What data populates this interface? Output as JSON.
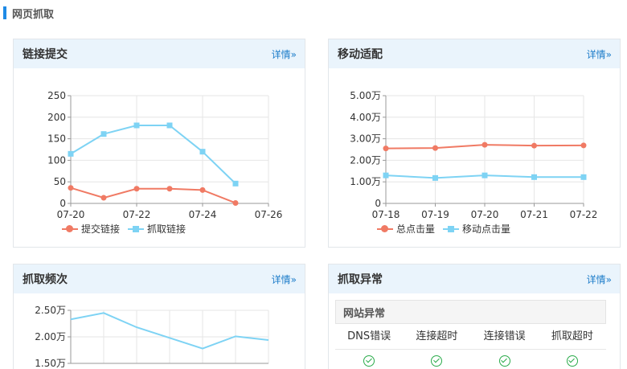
{
  "section": {
    "title": "网页抓取"
  },
  "cards": {
    "link_submit": {
      "title": "链接提交",
      "more_label": "详情»"
    },
    "mobile_adapt": {
      "title": "移动适配",
      "more_label": "详情»"
    },
    "crawl_freq": {
      "title": "抓取频次",
      "more_label": "详情»"
    },
    "crawl_error": {
      "title": "抓取异常",
      "more_label": "详情»",
      "sub_title": "网站异常",
      "columns": [
        "DNS错误",
        "连接超时",
        "连接错误",
        "抓取超时"
      ],
      "status": [
        "ok",
        "ok",
        "ok",
        "ok"
      ]
    }
  },
  "colors": {
    "red_series": "#f07a64",
    "blue_series": "#7ed3f4",
    "link": "#1b7bc9",
    "header_bg": "#eaf4fc",
    "ok": "#2aab4a"
  },
  "chart_data": [
    {
      "id": "link_submit",
      "type": "line",
      "x_ticks": [
        "07-20",
        "07-22",
        "07-24",
        "07-26"
      ],
      "y_ticks": [
        "0",
        "50",
        "100",
        "150",
        "200",
        "250"
      ],
      "ylim": [
        0,
        250
      ],
      "grid": true,
      "legend_position": "bottom",
      "series": [
        {
          "name": "提交链接",
          "color": "#f07a64",
          "marker": "circle",
          "x": [
            "07-20",
            "07-21",
            "07-22",
            "07-23",
            "07-24",
            "07-25"
          ],
          "values": [
            36,
            13,
            34,
            34,
            31,
            1
          ]
        },
        {
          "name": "抓取链接",
          "color": "#7ed3f4",
          "marker": "square",
          "x": [
            "07-20",
            "07-21",
            "07-22",
            "07-23",
            "07-24",
            "07-25"
          ],
          "values": [
            115,
            161,
            181,
            181,
            120,
            46
          ]
        }
      ]
    },
    {
      "id": "mobile_adapt",
      "type": "line",
      "x_ticks": [
        "07-18",
        "07-19",
        "07-20",
        "07-21",
        "07-22"
      ],
      "y_ticks": [
        "0",
        "1.00万",
        "2.00万",
        "3.00万",
        "4.00万",
        "5.00万"
      ],
      "ylim": [
        0,
        5
      ],
      "y_unit": "万",
      "grid": true,
      "legend_position": "bottom",
      "series": [
        {
          "name": "总点击量",
          "color": "#f07a64",
          "marker": "circle",
          "x": [
            "07-18",
            "07-19",
            "07-20",
            "07-21",
            "07-22"
          ],
          "values": [
            2.55,
            2.57,
            2.72,
            2.68,
            2.69
          ]
        },
        {
          "name": "移动点击量",
          "color": "#7ed3f4",
          "marker": "square",
          "x": [
            "07-18",
            "07-19",
            "07-20",
            "07-21",
            "07-22"
          ],
          "values": [
            1.3,
            1.18,
            1.3,
            1.22,
            1.22
          ]
        }
      ]
    },
    {
      "id": "crawl_freq",
      "type": "line",
      "y_ticks": [
        "1.50万",
        "2.00万",
        "2.50万"
      ],
      "ylim": [
        1.5,
        2.5
      ],
      "y_unit": "万",
      "grid": true,
      "series": [
        {
          "color": "#7ed3f4",
          "marker": "none",
          "values": [
            2.33,
            2.45,
            2.18,
            1.98,
            1.78,
            2.01,
            1.94
          ]
        }
      ]
    }
  ]
}
